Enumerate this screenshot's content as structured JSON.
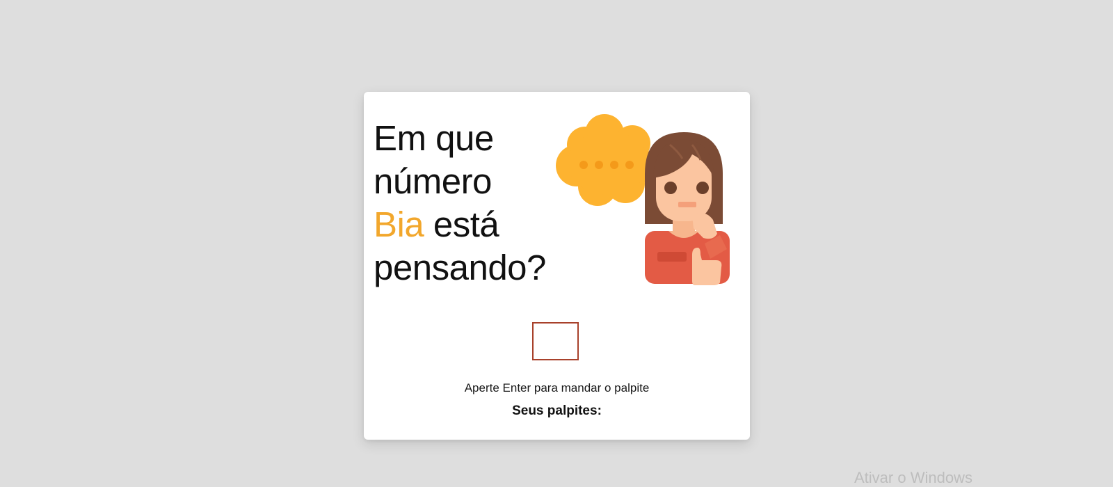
{
  "title": {
    "line1": "Em que",
    "line2": "número",
    "name": "Bia",
    "line3_rest": " está",
    "line4": "pensando?"
  },
  "illustration": {
    "icon": "thinking-girl-illustration",
    "bubble_icon": "thought-bubble-icon"
  },
  "guess_input": {
    "value": "",
    "placeholder": ""
  },
  "hint": "Aperte Enter para mandar o palpite",
  "guesses_heading": "Seus palpites:",
  "watermark": "Ativar o Windows",
  "colors": {
    "background": "#dedede",
    "accent": "#f2a72c",
    "input_border": "#a8412b"
  }
}
